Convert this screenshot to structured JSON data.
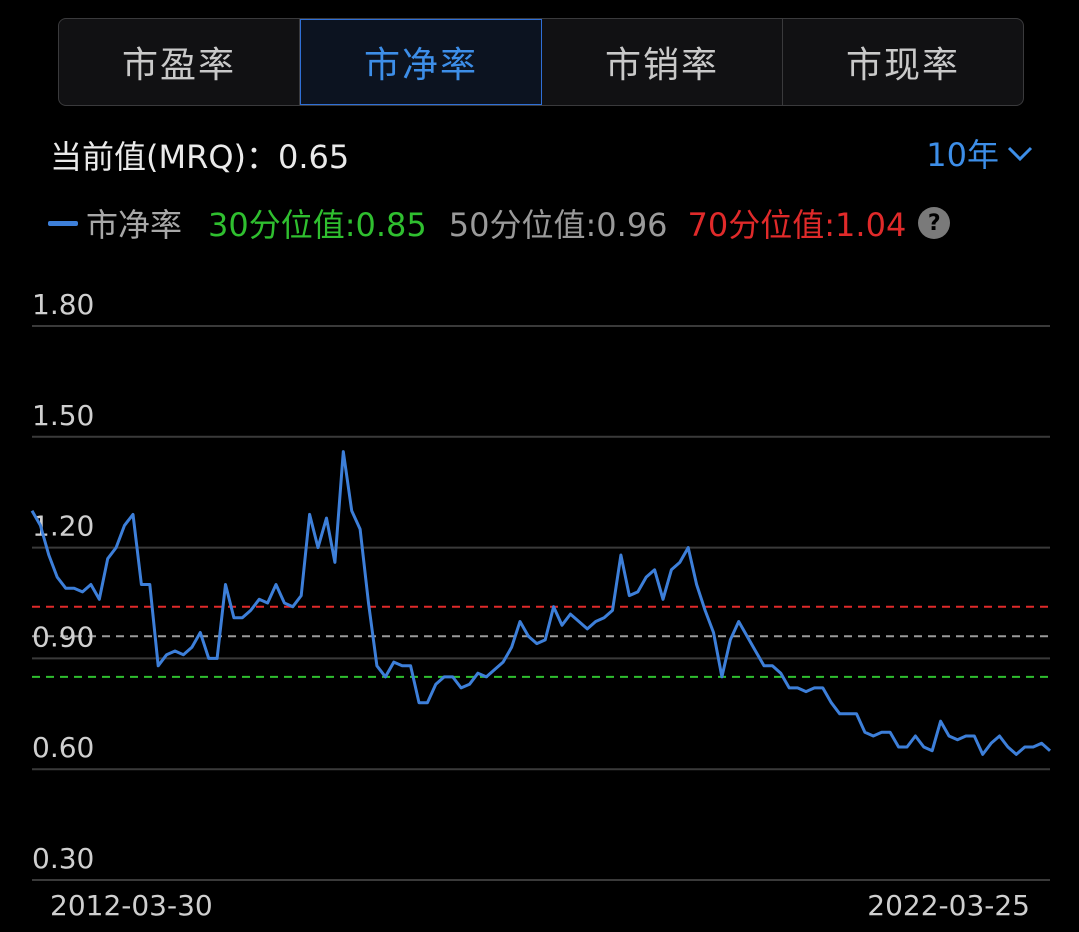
{
  "tabs": [
    {
      "label": "市盈率",
      "active": false
    },
    {
      "label": "市净率",
      "active": true
    },
    {
      "label": "市销率",
      "active": false
    },
    {
      "label": "市现率",
      "active": false
    }
  ],
  "current": {
    "label": "当前值(MRQ)：",
    "value": "0.65"
  },
  "period": {
    "label": "10年"
  },
  "legend": {
    "series_name": "市净率",
    "q30": "30分位值:0.85",
    "q50": "50分位值:0.96",
    "q70": "70分位值:1.04",
    "help": "?"
  },
  "colors": {
    "line": "#3d7fd9",
    "accent": "#3d8ee8",
    "q30": "#2fbf2f",
    "q50": "#9a9a9a",
    "q70": "#e02a2a",
    "grid": "#3a3a3a"
  },
  "chart_data": {
    "type": "line",
    "series": [
      {
        "name": "市净率",
        "values": [
          1.3,
          1.26,
          1.18,
          1.12,
          1.09,
          1.09,
          1.08,
          1.1,
          1.06,
          1.17,
          1.2,
          1.26,
          1.29,
          1.1,
          1.1,
          0.88,
          0.91,
          0.92,
          0.91,
          0.93,
          0.97,
          0.9,
          0.9,
          1.1,
          1.01,
          1.01,
          1.03,
          1.06,
          1.05,
          1.1,
          1.05,
          1.04,
          1.07,
          1.29,
          1.2,
          1.28,
          1.16,
          1.46,
          1.3,
          1.25,
          1.05,
          0.88,
          0.85,
          0.89,
          0.88,
          0.88,
          0.78,
          0.78,
          0.83,
          0.85,
          0.85,
          0.82,
          0.83,
          0.86,
          0.85,
          0.87,
          0.89,
          0.93,
          1.0,
          0.96,
          0.94,
          0.95,
          1.04,
          0.99,
          1.02,
          1.0,
          0.98,
          1.0,
          1.01,
          1.03,
          1.18,
          1.07,
          1.08,
          1.12,
          1.14,
          1.06,
          1.14,
          1.16,
          1.2,
          1.1,
          1.03,
          0.97,
          0.85,
          0.95,
          1.0,
          0.96,
          0.92,
          0.88,
          0.88,
          0.86,
          0.82,
          0.82,
          0.81,
          0.82,
          0.82,
          0.78,
          0.75,
          0.75,
          0.75,
          0.7,
          0.69,
          0.7,
          0.7,
          0.66,
          0.66,
          0.69,
          0.66,
          0.65,
          0.73,
          0.69,
          0.68,
          0.69,
          0.69,
          0.64,
          0.67,
          0.69,
          0.66,
          0.64,
          0.66,
          0.66,
          0.67,
          0.65
        ]
      }
    ],
    "x_start_label": "2012-03-30",
    "x_end_label": "2022-03-25",
    "yticks": [
      "1.80",
      "1.50",
      "1.20",
      "0.90",
      "0.60",
      "0.30"
    ],
    "ylim": [
      0.3,
      1.8
    ],
    "reference_lines": [
      {
        "name": "30分位值",
        "value": 0.85
      },
      {
        "name": "50分位值",
        "value": 0.96
      },
      {
        "name": "70分位值",
        "value": 1.04
      }
    ],
    "grid": true
  }
}
